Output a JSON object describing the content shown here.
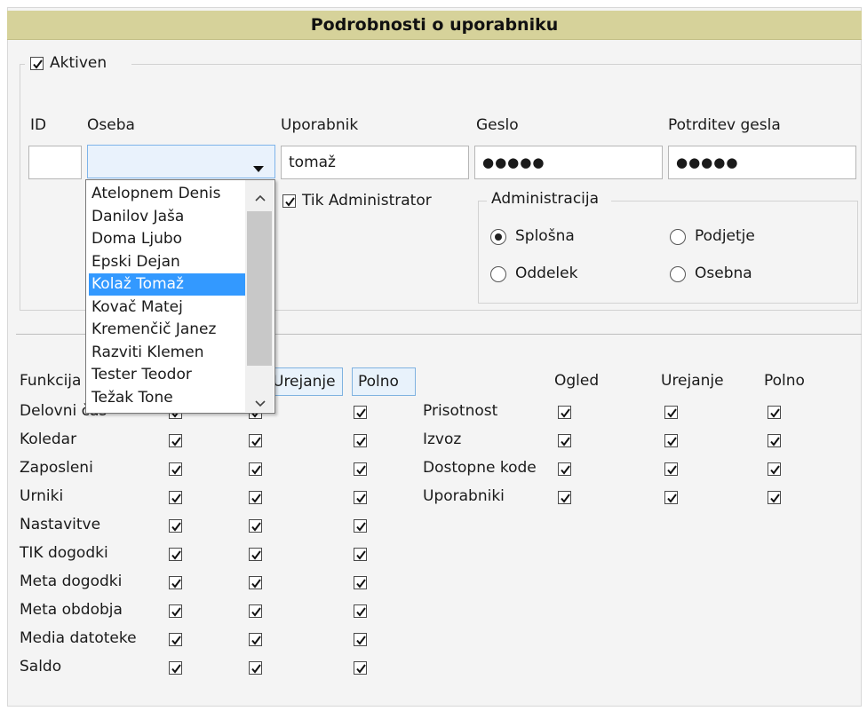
{
  "header": {
    "title": "Podrobnosti o uporabniku"
  },
  "active": {
    "label": "Aktiven",
    "checked": true
  },
  "fields": {
    "id_label": "ID",
    "oseba_label": "Oseba",
    "uporabnik_label": "Uporabnik",
    "uporabnik_value": "tomaž",
    "geslo_label": "Geslo",
    "geslo_value": "●●●●●",
    "potrditev_label": "Potrditev gesla",
    "potrditev_value": "●●●●●"
  },
  "tik_admin": {
    "label": "Tik Administrator",
    "checked": true
  },
  "administracija": {
    "title": "Administracija",
    "options": [
      "Splošna",
      "Podjetje",
      "Oddelek",
      "Osebna"
    ],
    "selected": "Splošna"
  },
  "dropdown": {
    "items": [
      "Atelopnem Denis",
      "Danilov Jaša",
      "Doma Ljubo",
      "Epski Dejan",
      "Kolaž Tomaž",
      "Kovač Matej",
      "Kremenčič Janez",
      "Razviti Klemen",
      "Tester Teodor",
      "Težak Tone"
    ],
    "selected": "Kolaž Tomaž"
  },
  "permissions": {
    "left_header": {
      "funkcija": "Funkcija",
      "urejanje": "Urejanje",
      "polno": "Polno"
    },
    "left_rows": [
      {
        "name": "Delovni čas"
      },
      {
        "name": "Koledar"
      },
      {
        "name": "Zaposleni"
      },
      {
        "name": "Urniki"
      },
      {
        "name": "Nastavitve"
      },
      {
        "name": "TIK dogodki"
      },
      {
        "name": "Meta dogodki"
      },
      {
        "name": "Meta obdobja"
      },
      {
        "name": "Media datoteke"
      },
      {
        "name": "Saldo"
      }
    ],
    "right_header": {
      "ogled": "Ogled",
      "urejanje": "Urejanje",
      "polno": "Polno"
    },
    "right_rows": [
      {
        "name": "Prisotnost"
      },
      {
        "name": "Izvoz"
      },
      {
        "name": "Dostopne kode"
      },
      {
        "name": "Uporabniki"
      }
    ]
  }
}
